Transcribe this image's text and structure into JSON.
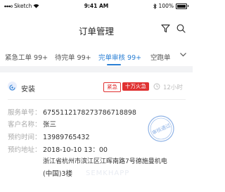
{
  "status_bar": {
    "carrier": "Sketch",
    "time": "9:41 AM",
    "battery": "100%"
  },
  "nav": {
    "title": "订单管理",
    "filter_icon": "filter-icon",
    "search_icon": "search-icon"
  },
  "tabs": [
    {
      "label": "紧急工单 99+",
      "active": false
    },
    {
      "label": "待完单 99+",
      "active": false
    },
    {
      "label": "完单审核 99+",
      "active": true
    },
    {
      "label": "空跑单",
      "active": false
    }
  ],
  "colors": {
    "accent": "#2a7fd4",
    "urgent": "#e03131",
    "muted": "#aaaaaa"
  },
  "order": {
    "type": "安装",
    "badge_urgent": "紧急",
    "badge_fire": "十万火急",
    "elapsed": "12小时",
    "fields": [
      {
        "label": "服务单号：",
        "value": "6755112178273786718898"
      },
      {
        "label": "客户名称：",
        "value": "张三"
      },
      {
        "label": "预约时间：",
        "value": "13989765432"
      },
      {
        "label": "预约地址：",
        "value": "2018-10-10  13：00"
      }
    ],
    "address_line1": "浙江省杭州市滨江区江晖南路7号德施曼机电",
    "address_line2": "(中国)3楼",
    "stamp_text": "审核通过"
  },
  "watermark": "SEMKHAPP"
}
